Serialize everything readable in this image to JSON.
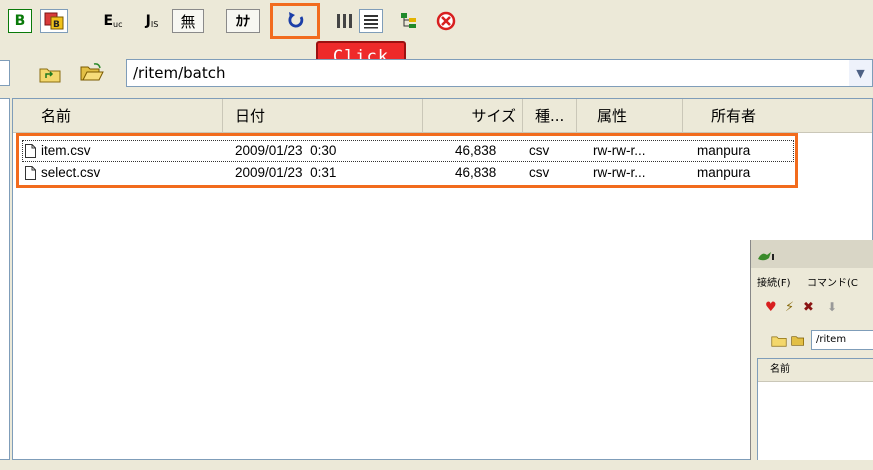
{
  "toolbar": {
    "btn_b": "B",
    "btn_eu": "E",
    "btn_eu_sub": "uc",
    "btn_jis": "J",
    "btn_jis_sub": "IS",
    "btn_none": "無",
    "btn_kana": "ｶﾅ",
    "refresh_icon": "refresh-icon",
    "accent_highlight": "#f26b1d"
  },
  "callout": {
    "label": "Click",
    "color": "#ee2a2a"
  },
  "path": {
    "value": "/ritem/batch"
  },
  "columns": {
    "name": "名前",
    "date": "日付",
    "size": "サイズ",
    "type": "種...",
    "attr": "属性",
    "owner": "所有者"
  },
  "files": [
    {
      "name": "item.csv",
      "date": "2009/01/23  0:30",
      "size": "46,838",
      "type": "csv",
      "attr": "rw-rw-r...",
      "owner": "manpura"
    },
    {
      "name": "select.csv",
      "date": "2009/01/23  0:31",
      "size": "46,838",
      "type": "csv",
      "attr": "rw-rw-r...",
      "owner": "manpura"
    }
  ],
  "mini_window": {
    "menu_connect": "接続(F)",
    "menu_command": "コマンド(C",
    "path": "/ritem",
    "col_name": "名前"
  }
}
